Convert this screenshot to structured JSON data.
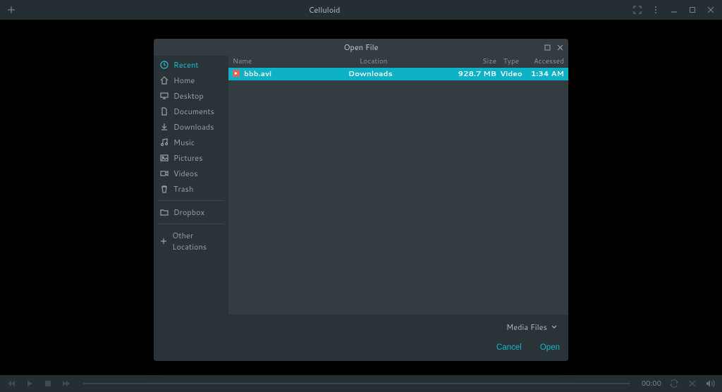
{
  "app_title": "Celluloid",
  "controls": {
    "time": "00:00"
  },
  "dialog": {
    "title": "Open File",
    "columns": {
      "name": "Name",
      "location": "Location",
      "size": "Size",
      "type": "Type",
      "accessed": "Accessed"
    },
    "filter_label": "Media Files",
    "cancel_label": "Cancel",
    "open_label": "Open"
  },
  "sidebar": {
    "items": [
      {
        "label": "Recent",
        "icon": "clock-icon",
        "active": true
      },
      {
        "label": "Home",
        "icon": "home-icon"
      },
      {
        "label": "Desktop",
        "icon": "desktop-icon"
      },
      {
        "label": "Documents",
        "icon": "document-icon"
      },
      {
        "label": "Downloads",
        "icon": "download-icon"
      },
      {
        "label": "Music",
        "icon": "music-icon"
      },
      {
        "label": "Pictures",
        "icon": "picture-icon"
      },
      {
        "label": "Videos",
        "icon": "video-icon"
      },
      {
        "label": "Trash",
        "icon": "trash-icon"
      },
      {
        "label": "Dropbox",
        "icon": "folder-icon"
      },
      {
        "label": "Other Locations",
        "icon": "plus-icon"
      }
    ]
  },
  "files": [
    {
      "name": "bbb.avi",
      "location": "Downloads",
      "size": "928.7 MB",
      "type": "Video",
      "accessed": "1:34 AM",
      "selected": true
    }
  ]
}
